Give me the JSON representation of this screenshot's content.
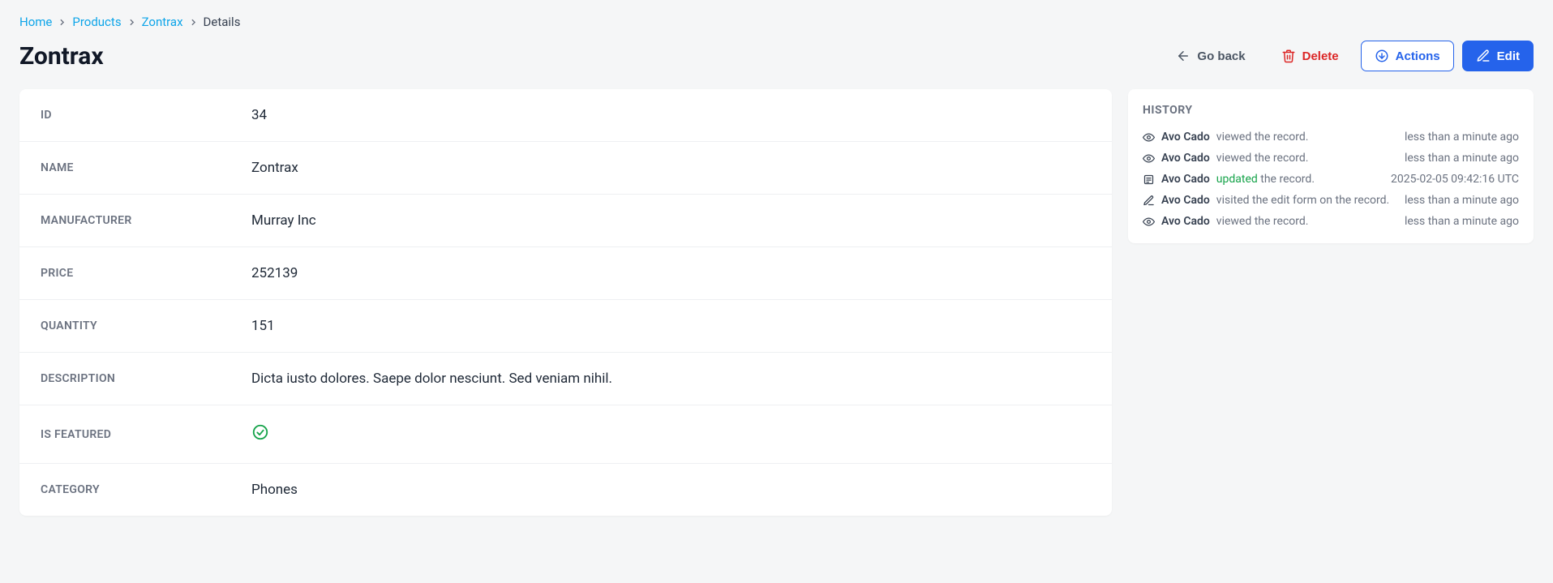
{
  "breadcrumb": {
    "home": "Home",
    "products": "Products",
    "product": "Zontrax",
    "details": "Details"
  },
  "page": {
    "title": "Zontrax"
  },
  "actions": {
    "go_back": "Go back",
    "delete": "Delete",
    "actions": "Actions",
    "edit": "Edit"
  },
  "fields": {
    "id_label": "ID",
    "id_value": "34",
    "name_label": "NAME",
    "name_value": "Zontrax",
    "manufacturer_label": "MANUFACTURER",
    "manufacturer_value": "Murray Inc",
    "price_label": "PRICE",
    "price_value": "252139",
    "quantity_label": "QUANTITY",
    "quantity_value": "151",
    "description_label": "DESCRIPTION",
    "description_value": "Dicta iusto dolores. Saepe dolor nesciunt. Sed veniam nihil.",
    "is_featured_label": "IS FEATURED",
    "is_featured_value": true,
    "category_label": "CATEGORY",
    "category_value": "Phones"
  },
  "history": {
    "title": "HISTORY",
    "items": [
      {
        "icon": "eye",
        "user": "Avo Cado",
        "verb": "viewed",
        "verb_text": "viewed the record.",
        "time": "less than a minute ago"
      },
      {
        "icon": "eye",
        "user": "Avo Cado",
        "verb": "viewed",
        "verb_text": "viewed the record.",
        "time": "less than a minute ago"
      },
      {
        "icon": "update",
        "user": "Avo Cado",
        "verb": "updated",
        "verb_text_pre": "updated",
        "verb_text_post": " the record.",
        "time": "2025-02-05 09:42:16 UTC"
      },
      {
        "icon": "edit",
        "user": "Avo Cado",
        "verb": "visited",
        "verb_text": "visited the edit form on the record.",
        "time": "less than a minute ago"
      },
      {
        "icon": "eye",
        "user": "Avo Cado",
        "verb": "viewed",
        "verb_text": "viewed the record.",
        "time": "less than a minute ago"
      }
    ]
  }
}
